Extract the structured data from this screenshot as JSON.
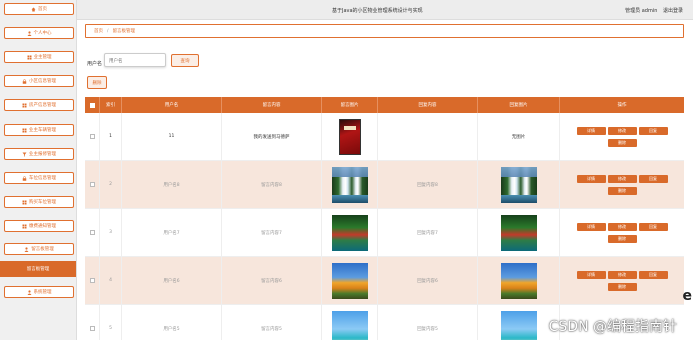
{
  "header": {
    "system_title": "基于Java的小区物业管理系统设计与实现",
    "user_label": "管理员 admin",
    "logout_label": "退出登录"
  },
  "sidebar": {
    "items": [
      {
        "label": "首页",
        "icon": "home-icon"
      },
      {
        "label": "个人中心",
        "icon": "person-icon"
      },
      {
        "label": "业主管理",
        "icon": "grid-icon"
      },
      {
        "label": "小区信息管理",
        "icon": "lock-icon"
      },
      {
        "label": "房产信息管理",
        "icon": "grid-icon"
      },
      {
        "label": "业主车辆管理",
        "icon": "grid-icon"
      },
      {
        "label": "业主报修管理",
        "icon": "flag-icon"
      },
      {
        "label": "车位信息管理",
        "icon": "lock-icon"
      },
      {
        "label": "购买车位管理",
        "icon": "grid-icon"
      },
      {
        "label": "缴费通知管理",
        "icon": "grid-icon"
      },
      {
        "label": "留言板管理",
        "icon": "person-icon"
      },
      {
        "label": "留言板管理",
        "icon": "",
        "active": true
      },
      {
        "label": "系统管理",
        "icon": "person-icon"
      }
    ]
  },
  "breadcrumb": {
    "home": "首页",
    "separator": "/",
    "current": "留言板管理"
  },
  "search": {
    "label": "用户名",
    "placeholder": "用户名",
    "query_button": "查询"
  },
  "actions": {
    "delete_button": "删除"
  },
  "table": {
    "columns": [
      "",
      "索引",
      "用户名",
      "留言内容",
      "留言图片",
      "回复内容",
      "回复图片",
      "操作"
    ],
    "rows": [
      {
        "index": "1",
        "username": "11",
        "content": "我的发送到马德萨",
        "image": "book",
        "reply": "",
        "reply_image": "无图片"
      },
      {
        "index": "2",
        "username": "用户名8",
        "content": "留言内容8",
        "image": "waterfall",
        "reply": "回复内容8",
        "reply_image": "waterfall"
      },
      {
        "index": "3",
        "username": "用户名7",
        "content": "留言内容7",
        "image": "forest",
        "reply": "回复内容7",
        "reply_image": "forest"
      },
      {
        "index": "4",
        "username": "用户名6",
        "content": "留言内容6",
        "image": "tree",
        "reply": "回复内容6",
        "reply_image": "tree"
      },
      {
        "index": "5",
        "username": "用户名5",
        "content": "留言内容5",
        "image": "sea",
        "reply": "回复内容5",
        "reply_image": "sea"
      }
    ],
    "row_buttons": {
      "detail": "详情",
      "edit": "修改",
      "reply": "回复",
      "delete": "删除"
    }
  },
  "watermark": "CSDN @编程指南针",
  "colors": {
    "accent": "#d96a2a",
    "accent_light": "#fbeee6",
    "row_alt": "#f7e6dc"
  }
}
